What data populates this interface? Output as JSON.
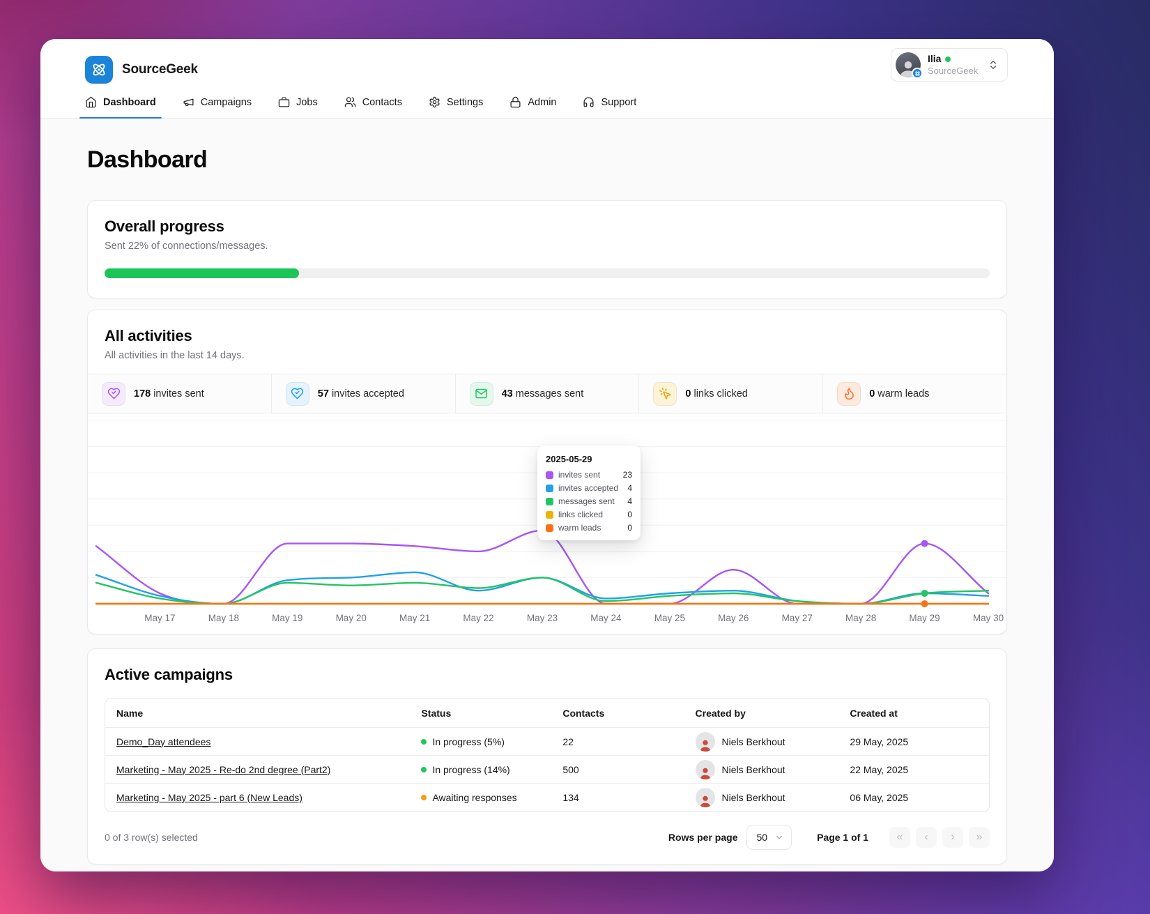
{
  "app": {
    "name": "SourceGeek",
    "brand_color": "#1b84d9"
  },
  "user": {
    "name": "Ilia",
    "org": "SourceGeek",
    "status_color": "#22c55e"
  },
  "nav": {
    "items": [
      {
        "label": "Dashboard",
        "active": true
      },
      {
        "label": "Campaigns",
        "active": false
      },
      {
        "label": "Jobs",
        "active": false
      },
      {
        "label": "Contacts",
        "active": false
      },
      {
        "label": "Settings",
        "active": false
      },
      {
        "label": "Admin",
        "active": false
      },
      {
        "label": "Support",
        "active": false
      }
    ]
  },
  "page": {
    "title": "Dashboard"
  },
  "overall_progress": {
    "title": "Overall progress",
    "subtitle": "Sent 22% of connections/messages.",
    "percent": 22,
    "bar_color": "#1bc558"
  },
  "activities": {
    "title": "All activities",
    "subtitle": "All activities in the last 14 days.",
    "stats": [
      {
        "value": "178",
        "label": "invites sent",
        "color": "#a855f7",
        "bg": "#f5ebff"
      },
      {
        "value": "57",
        "label": "invites accepted",
        "color": "#2299ec",
        "bg": "#e4f3fe"
      },
      {
        "value": "43",
        "label": "messages sent",
        "color": "#23c466",
        "bg": "#e4f9ec"
      },
      {
        "value": "0",
        "label": "links clicked",
        "color": "#e9a50b",
        "bg": "#fdf3d7"
      },
      {
        "value": "0",
        "label": "warm leads",
        "color": "#f4732c",
        "bg": "#ffeadd"
      }
    ]
  },
  "chart_data": {
    "type": "line",
    "x": [
      "May 17",
      "May 18",
      "May 19",
      "May 20",
      "May 21",
      "May 22",
      "May 23",
      "May 24",
      "May 25",
      "May 26",
      "May 27",
      "May 28",
      "May 29",
      "May 30"
    ],
    "series": [
      {
        "name": "invites sent",
        "color": "#a855f7",
        "edge_start": 22,
        "values": [
          4,
          0,
          23,
          23,
          22,
          20,
          28,
          0,
          0,
          13,
          0,
          0,
          23,
          4
        ],
        "dot": true
      },
      {
        "name": "invites accepted",
        "color": "#22a0e9",
        "edge_start": 11,
        "values": [
          3,
          0,
          9,
          10,
          12,
          5,
          10,
          2,
          4,
          5,
          1,
          0,
          4,
          3
        ],
        "dot": false
      },
      {
        "name": "messages sent",
        "color": "#23c466",
        "edge_start": 8,
        "values": [
          2,
          0,
          8,
          7,
          8,
          6,
          10,
          1,
          3,
          4,
          1,
          0,
          4,
          5
        ],
        "dot": true
      },
      {
        "name": "links clicked",
        "color": "#eab308",
        "edge_start": 0,
        "values": [
          0,
          0,
          0,
          0,
          0,
          0,
          0,
          0,
          0,
          0,
          0,
          0,
          0,
          0
        ],
        "dot": false
      },
      {
        "name": "warm leads",
        "color": "#f97316",
        "edge_start": 0,
        "values": [
          0,
          0,
          0,
          0,
          0,
          0,
          0,
          0,
          0,
          0,
          0,
          0,
          0,
          0
        ],
        "dot": true
      }
    ],
    "ylim": [
      0,
      70
    ],
    "grid": true,
    "legend_position": "tooltip-only",
    "highlight_index": 12
  },
  "tooltip": {
    "date": "2025-05-29",
    "rows": [
      {
        "label": "invites sent",
        "value": "23",
        "color": "#a855f7"
      },
      {
        "label": "invites accepted",
        "value": "4",
        "color": "#22a0e9"
      },
      {
        "label": "messages sent",
        "value": "4",
        "color": "#23c466"
      },
      {
        "label": "links clicked",
        "value": "0",
        "color": "#eab308"
      },
      {
        "label": "warm leads",
        "value": "0",
        "color": "#f97316"
      }
    ]
  },
  "campaigns": {
    "title": "Active campaigns",
    "columns": [
      "Name",
      "Status",
      "Contacts",
      "Created by",
      "Created at"
    ],
    "rows": [
      {
        "name": "Demo_Day attendees",
        "status": "In progress (5%)",
        "status_color": "#22c55e",
        "contacts": "22",
        "created_by": "Niels Berkhout",
        "created_at": "29 May, 2025"
      },
      {
        "name": "Marketing - May 2025 - Re-do 2nd degree (Part2)",
        "status": "In progress (14%)",
        "status_color": "#22c55e",
        "contacts": "500",
        "created_by": "Niels Berkhout",
        "created_at": "22 May, 2025"
      },
      {
        "name": "Marketing - May 2025 - part 6 (New Leads)",
        "status": "Awaiting responses",
        "status_color": "#f59e0b",
        "contacts": "134",
        "created_by": "Niels Berkhout",
        "created_at": "06 May, 2025"
      }
    ],
    "footer": {
      "selected": "0 of 3 row(s) selected",
      "rows_per_page_label": "Rows per page",
      "rows_per_page_value": "50",
      "page_status": "Page 1 of 1",
      "pager": [
        "«",
        "‹",
        "›",
        "»"
      ]
    }
  }
}
